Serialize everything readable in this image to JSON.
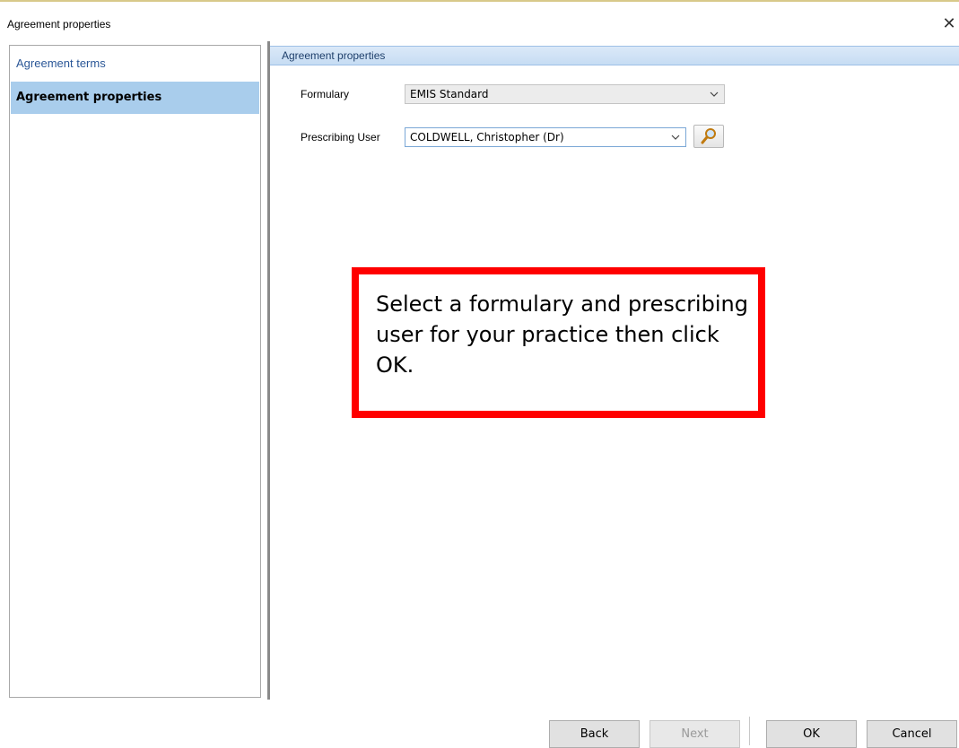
{
  "window": {
    "title": "Agreement properties",
    "close_glyph": "✕"
  },
  "nav": {
    "items": [
      {
        "label": "Agreement terms"
      },
      {
        "label": "Agreement properties"
      }
    ]
  },
  "section": {
    "header": "Agreement properties"
  },
  "form": {
    "formulary_label": "Formulary",
    "formulary_value": "EMIS Standard",
    "prescriber_label": "Prescribing User",
    "prescriber_value": "COLDWELL, Christopher (Dr)"
  },
  "callout": {
    "text": "Select a formulary and prescribing user for your practice then click OK.",
    "border_color": "#ff0000"
  },
  "buttons": {
    "back": "Back",
    "next": "Next",
    "ok": "OK",
    "cancel": "Cancel"
  },
  "icons": {
    "close": "close-icon",
    "chevron": "chevron-down-icon",
    "search": "magnifier-icon"
  },
  "colors": {
    "nav_active_bg": "#a9cdec",
    "header_bg": "#c6dcf3"
  }
}
